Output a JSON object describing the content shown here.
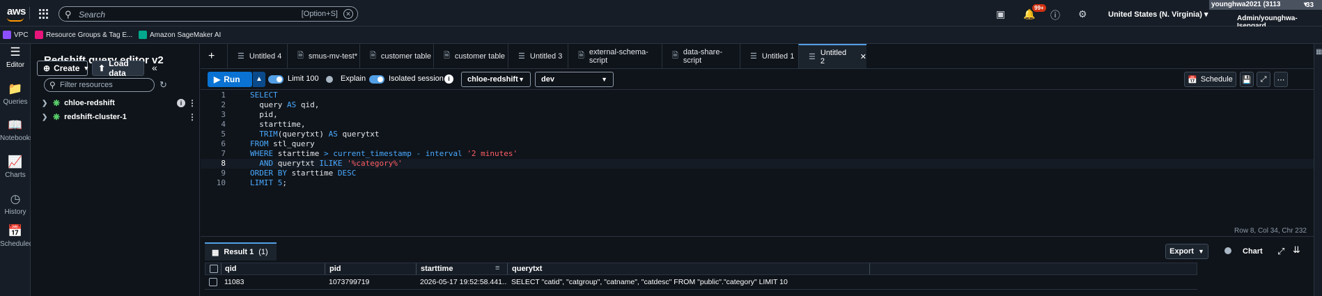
{
  "topbar": {
    "search_placeholder": "Search",
    "search_shortcut": "[Option+S]",
    "notifications_badge": "99+",
    "region": "United States (N. Virginia)",
    "account_name": "younghwa2021 (3113",
    "account_num": "33",
    "account_role": "Admin/younghwa-Isengard"
  },
  "favorites": [
    {
      "label": "VPC",
      "color": "#8c4fff"
    },
    {
      "label": "Resource Groups & Tag E...",
      "color": "#e7157b"
    },
    {
      "label": "Amazon SageMaker AI",
      "color": "#01a88d"
    }
  ],
  "rail": [
    {
      "label": "Editor",
      "icon": "editor-icon"
    },
    {
      "label": "Queries",
      "icon": "folder-icon"
    },
    {
      "label": "Notebooks",
      "icon": "notebook-icon"
    },
    {
      "label": "Charts",
      "icon": "chart-icon"
    },
    {
      "label": "History",
      "icon": "clock-icon"
    },
    {
      "label": "Scheduled",
      "icon": "calendar-icon"
    }
  ],
  "sidepanel": {
    "title": "Redshift query editor v2",
    "create_label": "Create",
    "load_label": "Load data",
    "filter_placeholder": "Filter resources",
    "tree": [
      {
        "label": "chloe-redshift"
      },
      {
        "label": "redshift-cluster-1"
      }
    ]
  },
  "tabs": [
    {
      "label": "Untitled 4"
    },
    {
      "label": "smus-mv-test*"
    },
    {
      "label": "customer table"
    },
    {
      "label": "customer table"
    },
    {
      "label": "Untitled 3"
    },
    {
      "label": "external-schema-script"
    },
    {
      "label": "data-share-script"
    },
    {
      "label": "Untitled 1"
    },
    {
      "label": "Untitled 2"
    }
  ],
  "toolbar": {
    "run_label": "Run",
    "limit_label": "Limit 100",
    "explain_label": "Explain",
    "isolated_label": "Isolated session",
    "cluster": "chloe-redshift",
    "database": "dev",
    "schedule_label": "Schedule"
  },
  "editor": {
    "line_numbers": [
      "1",
      "2",
      "3",
      "4",
      "5",
      "6",
      "7",
      "8",
      "9",
      "10"
    ],
    "status": "Row 8,  Col 34,  Chr 232"
  },
  "results": {
    "tab_label": "Result 1",
    "tab_count": "(1)",
    "export_label": "Export",
    "chart_label": "Chart",
    "columns": [
      "qid",
      "pid",
      "starttime",
      "querytxt"
    ],
    "rows": [
      [
        "11083",
        "1073799719",
        "2026-05-17 19:52:58.441...",
        "SELECT \"catid\", \"catgroup\", \"catname\", \"catdesc\" FROM \"public\".\"category\" LIMIT 10"
      ]
    ]
  }
}
